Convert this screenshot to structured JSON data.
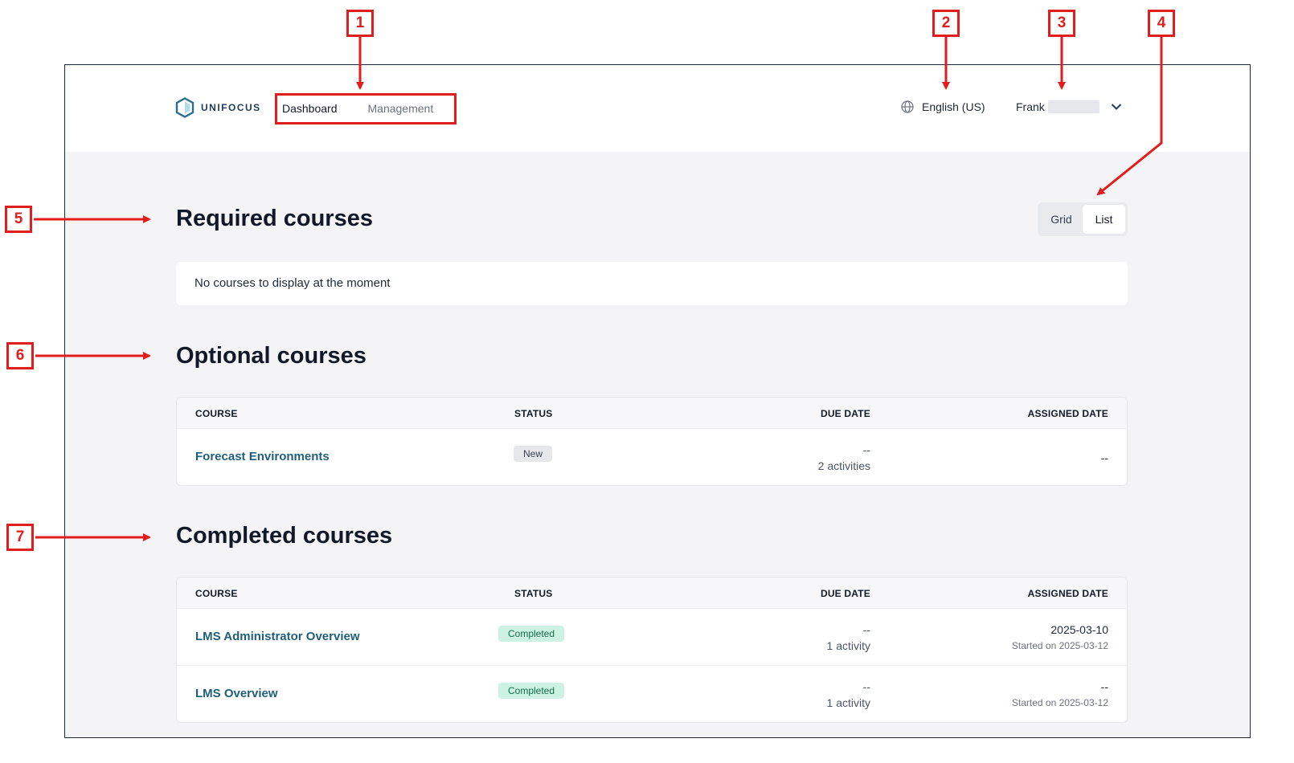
{
  "header": {
    "logo_text": "UNIFOCUS",
    "nav": [
      {
        "label": "Dashboard",
        "active": true
      },
      {
        "label": "Management",
        "active": false
      }
    ],
    "language": "English (US)",
    "user_name": "Frank"
  },
  "view_toggle": {
    "options": [
      "Grid",
      "List"
    ],
    "selected": "List"
  },
  "required": {
    "title": "Required courses",
    "empty_message": "No courses to display at the moment"
  },
  "optional": {
    "title": "Optional courses",
    "columns": [
      "COURSE",
      "STATUS",
      "DUE DATE",
      "ASSIGNED DATE"
    ],
    "rows": [
      {
        "course": "Forecast Environments",
        "status": "New",
        "due": "--",
        "activities": "2 activities",
        "assigned": "--",
        "started": ""
      }
    ]
  },
  "completed": {
    "title": "Completed courses",
    "columns": [
      "COURSE",
      "STATUS",
      "DUE DATE",
      "ASSIGNED DATE"
    ],
    "rows": [
      {
        "course": "LMS Administrator Overview",
        "status": "Completed",
        "due": "--",
        "activities": "1 activity",
        "assigned": "2025-03-10",
        "started": "Started on 2025-03-12"
      },
      {
        "course": "LMS Overview",
        "status": "Completed",
        "due": "--",
        "activities": "1 activity",
        "assigned": "--",
        "started": "Started on 2025-03-12"
      }
    ]
  },
  "annotations": [
    "1",
    "2",
    "3",
    "4",
    "5",
    "6",
    "7"
  ],
  "colors": {
    "annotation": "#e11d1d",
    "link": "#1f5f7a",
    "completed_badge": "#cdf1e2",
    "new_badge": "#e5e7eb"
  }
}
